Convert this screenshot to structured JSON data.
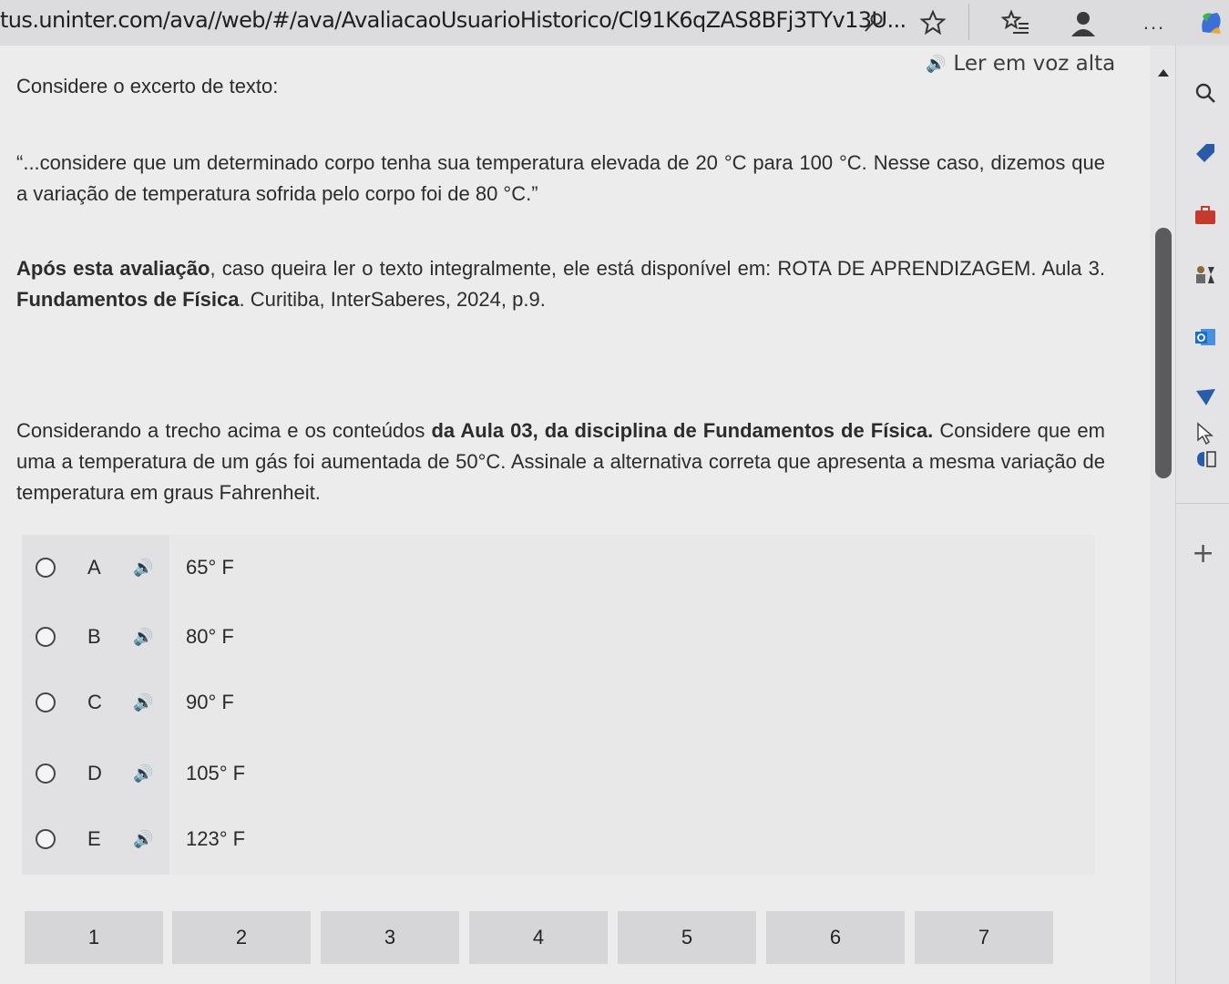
{
  "browser": {
    "url": "tus.uninter.com/ava//web/#/ava/AvaliacaoUsuarioHistorico/Cl91K6qZAS8BFj3TYv13U...",
    "more_label": "..."
  },
  "read_aloud": {
    "label": "Ler em voz alta"
  },
  "question": {
    "intro": "Considere o excerto de texto:",
    "quote": "“...considere que um determinado corpo tenha sua temperatura elevada de 20 °C para 100 °C. Nesse caso, dizemos que a variação de temperatura sofrida pelo corpo foi de 80 °C.”",
    "source_bold1": "Após esta avaliação",
    "source_text1": ", caso queira ler o texto integralmente, ele está disponível em: ROTA DE APRENDIZAGEM. Aula 3. ",
    "source_bold2": "Fundamentos de Física",
    "source_text2": ". Curitiba, InterSaberes, 2024, p.9.",
    "stem_text1": "Considerando a trecho acima e os conteúdos ",
    "stem_bold": "da Aula 03, da disciplina de Fundamentos de Física.",
    "stem_text2": " Considere que em uma a temperatura de um gás foi aumentada de 50°C. Assinale a alternativa correta que apresenta a mesma variação de temperatura em graus Fahrenheit."
  },
  "options": [
    {
      "letter": "A",
      "value": "65° F"
    },
    {
      "letter": "B",
      "value": "80° F"
    },
    {
      "letter": "C",
      "value": "90° F"
    },
    {
      "letter": "D",
      "value": "105° F"
    },
    {
      "letter": "E",
      "value": "123° F"
    }
  ],
  "pages": [
    "1",
    "2",
    "3",
    "4",
    "5",
    "6",
    "7"
  ],
  "sidebar": {
    "add_label": "+"
  },
  "icons": {
    "speaker": "🔊",
    "key": "⚲",
    "star": "☆",
    "favorites": "☆≡",
    "profile": "●",
    "search": "⚲",
    "tag": "◆",
    "briefcase": "■",
    "games": "♟",
    "outlook": "O",
    "drop": "▼",
    "cursor": "▷"
  },
  "colors": {
    "accent": "#2a5ba8",
    "briefcase": "#c43a2c",
    "outlook": "#1a6fc4"
  }
}
